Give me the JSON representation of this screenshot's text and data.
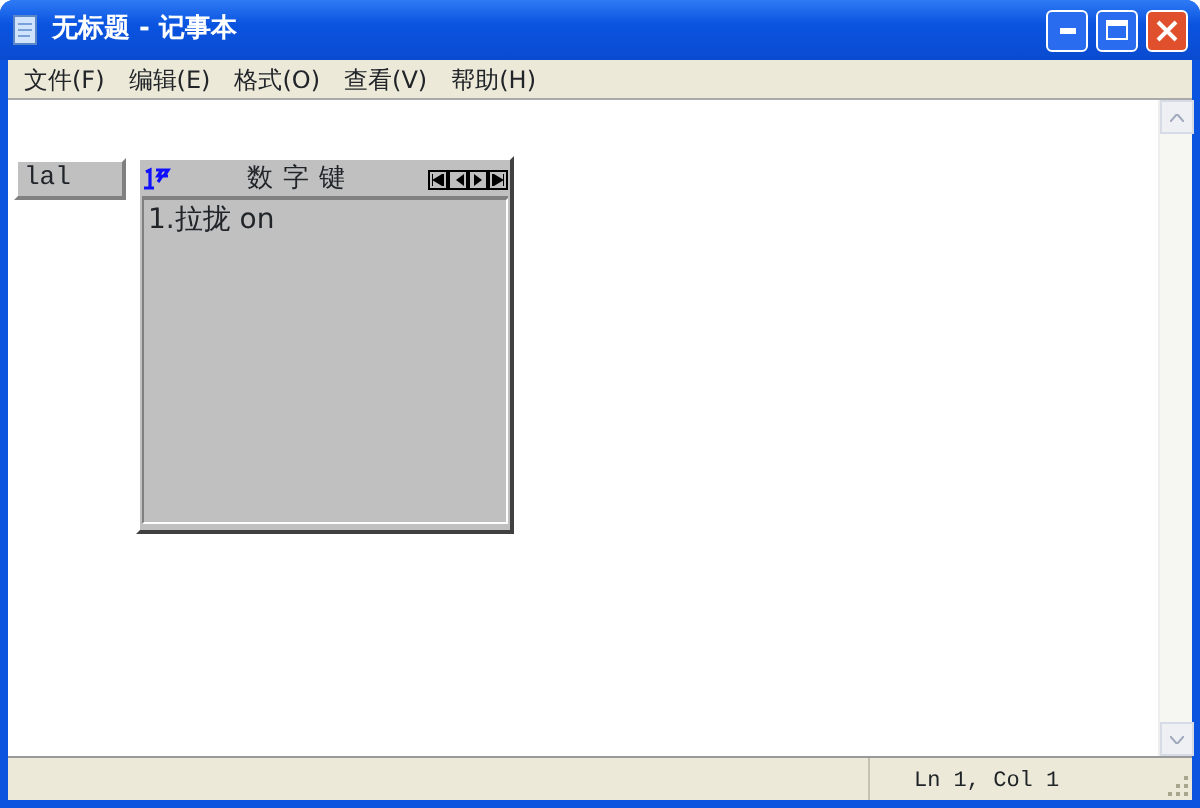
{
  "window": {
    "title": "无标题 - 记事本"
  },
  "menu": [
    "文件(F)",
    "编辑(E)",
    "格式(O)",
    "查看(V)",
    "帮助(H)"
  ],
  "ime": {
    "composition": "lal",
    "candidate_window": {
      "title": "数字键",
      "candidates": [
        "1.拉拢 on"
      ]
    }
  },
  "status_bar": {
    "position": "Ln 1, Col 1"
  }
}
